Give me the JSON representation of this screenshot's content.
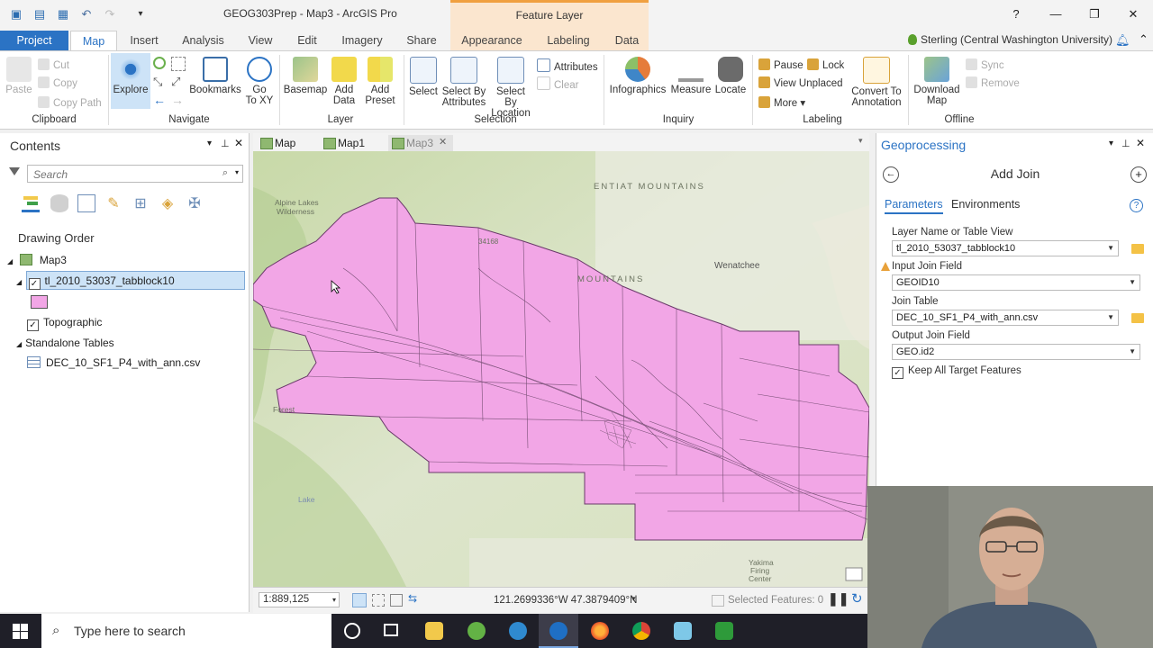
{
  "window": {
    "title": "GEOG303Prep - Map3 - ArcGIS Pro",
    "context_tab_group": "Feature Layer",
    "help": "?",
    "user": "Sterling (Central Washington University)"
  },
  "tabs": [
    "Project",
    "Map",
    "Insert",
    "Analysis",
    "View",
    "Edit",
    "Imagery",
    "Share",
    "Appearance",
    "Labeling",
    "Data"
  ],
  "ribbon": {
    "clipboard": {
      "paste": "Paste",
      "cut": "Cut",
      "copy": "Copy",
      "copy_path": "Copy Path",
      "group": "Clipboard"
    },
    "navigate": {
      "explore": "Explore",
      "bookmarks": "Bookmarks",
      "goto_line1": "Go",
      "goto_line2": "To XY",
      "group": "Navigate"
    },
    "layer": {
      "basemap": "Basemap",
      "add_data_1": "Add",
      "add_data_2": "Data",
      "add_preset_1": "Add",
      "add_preset_2": "Preset",
      "group": "Layer"
    },
    "selection": {
      "select": "Select",
      "by_attr_1": "Select By",
      "by_attr_2": "Attributes",
      "by_loc_1": "Select By",
      "by_loc_2": "Location",
      "attributes": "Attributes",
      "clear": "Clear",
      "group": "Selection"
    },
    "inquiry": {
      "infographics": "Infographics",
      "measure": "Measure",
      "locate": "Locate",
      "group": "Inquiry"
    },
    "labeling": {
      "pause": "Pause",
      "lock": "Lock",
      "view_unplaced": "View Unplaced",
      "more": "More",
      "convert_1": "Convert To",
      "convert_2": "Annotation",
      "group": "Labeling"
    },
    "offline": {
      "download_1": "Download",
      "download_2": "Map",
      "sync": "Sync",
      "remove": "Remove",
      "group": "Offline"
    }
  },
  "contents": {
    "title": "Contents",
    "search_placeholder": "Search",
    "drawing_order": "Drawing Order",
    "map_name": "Map3",
    "layer_name": "tl_2010_53037_tabblock10",
    "basemap_layer": "Topographic",
    "standalone_tables": "Standalone Tables",
    "table_name": "DEC_10_SF1_P4_with_ann.csv"
  },
  "map": {
    "tabs": [
      "Map",
      "Map1",
      "Map3"
    ],
    "labels": {
      "entiat": "ENTIAT MOUNTAINS",
      "wenatchee": "Wenatchee",
      "mountains": "MOUNTAINS",
      "alpine": "Alpine Lakes",
      "wilderness": "Wilderness",
      "peak": "34168",
      "lake": "Lake",
      "yakima_1": "Yakima",
      "yakima_2": "Firing",
      "yakima_3": "Center",
      "forest": "Forest"
    },
    "scale": "1:889,125",
    "coordinates": "121.2699336°W 47.3879409°N",
    "selected_features": "Selected Features: 0"
  },
  "geoprocessing": {
    "title": "Geoprocessing",
    "tool": "Add Join",
    "tab_parameters": "Parameters",
    "tab_environments": "Environments",
    "layer_label": "Layer Name or Table View",
    "layer_value": "tl_2010_53037_tabblock10",
    "input_field_label": "Input Join Field",
    "input_field_value": "GEOID10",
    "join_table_label": "Join Table",
    "join_table_value": "DEC_10_SF1_P4_with_ann.csv",
    "output_field_label": "Output Join Field",
    "output_field_value": "GEO.id2",
    "keep_all": "Keep All Target Features"
  },
  "taskbar": {
    "search_text": "Type here to search"
  },
  "colors": {
    "accent": "#2b73c4",
    "layer_fill": "#f2a6e6",
    "context": "#fbe6cf"
  }
}
